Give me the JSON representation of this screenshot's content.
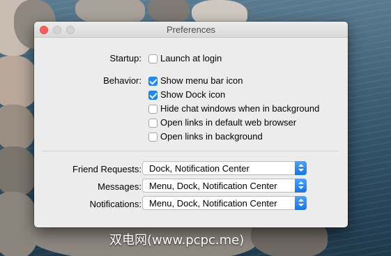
{
  "window": {
    "title": "Preferences"
  },
  "startup": {
    "label": "Startup:",
    "launch_at_login": {
      "label": "Launch at login",
      "checked": false
    }
  },
  "behavior": {
    "label": "Behavior:",
    "options": [
      {
        "label": "Show menu bar icon",
        "checked": true
      },
      {
        "label": "Show Dock icon",
        "checked": true
      },
      {
        "label": "Hide chat windows when in background",
        "checked": false
      },
      {
        "label": "Open links in default web browser",
        "checked": false
      },
      {
        "label": "Open links in background",
        "checked": false
      }
    ]
  },
  "notify": {
    "friend_requests": {
      "label": "Friend Requests:",
      "value": "Dock, Notification Center"
    },
    "messages": {
      "label": "Messages:",
      "value": "Menu, Dock, Notification Center"
    },
    "notifications": {
      "label": "Notifications:",
      "value": "Menu, Dock, Notification Center"
    }
  },
  "watermark": "双电网(www.pcpc.me)",
  "colors": {
    "accent": "#1d8cf8",
    "close_light": "#fc605c",
    "window_bg": "#ececec"
  }
}
